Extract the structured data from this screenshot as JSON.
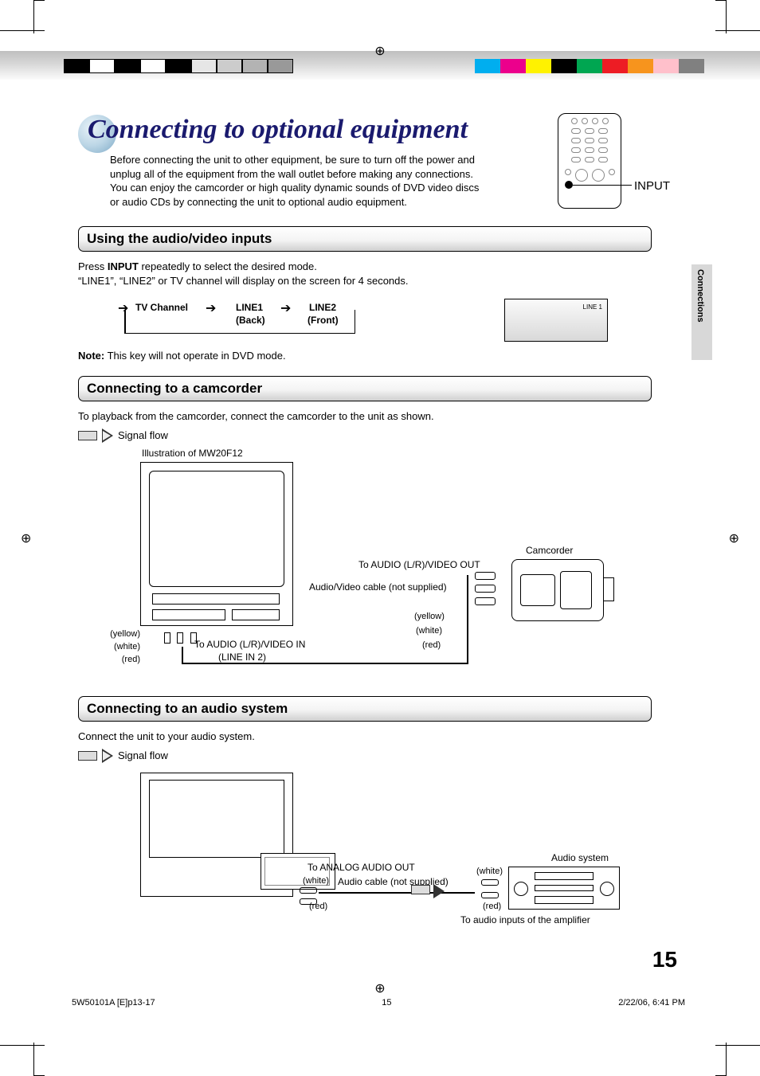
{
  "swatches_left": [
    "#000000",
    "#ffffff",
    "#000000",
    "#ffffff",
    "#000000",
    "#e6e6e6",
    "#cccccc",
    "#b3b3b3",
    "#999999"
  ],
  "swatches_right": [
    "#00aeef",
    "#ec008c",
    "#fff200",
    "#000000",
    "#00a651",
    "#ed1c24",
    "#f7941d",
    "#ffc0cb",
    "#808080"
  ],
  "title": "Connecting to optional equipment",
  "intro": "Before connecting the unit to other equipment, be sure to turn off the power and unplug all of the equipment from the wall outlet before making any connections. You can enjoy the camcorder or high quality dynamic sounds of DVD video discs or audio CDs by connecting the unit to optional audio equipment.",
  "input_label": "INPUT",
  "section1": {
    "heading": "Using the audio/video inputs",
    "line1_a": "Press ",
    "line1_b": "INPUT",
    "line1_c": " repeatedly to select the desired mode.",
    "line2": "“LINE1”, “LINE2” or TV channel will display on the screen for 4 seconds.",
    "cycle": {
      "stop1": "TV Channel",
      "stop2": "LINE1",
      "stop2_sub": "(Back)",
      "stop3": "LINE2",
      "stop3_sub": "(Front)"
    },
    "osd_label": "LINE 1",
    "note_b": "Note:",
    "note": " This key will not operate in DVD mode."
  },
  "section2": {
    "heading": "Connecting to a camcorder",
    "intro": "To playback from the camcorder, connect the camcorder to the unit as shown.",
    "signal_flow": "Signal flow",
    "illus": "Illustration of MW20F12",
    "labels": {
      "yellow": "(yellow)",
      "white": "(white)",
      "red": "(red)",
      "to_av_in_a": "To AUDIO (L/R)/VIDEO IN",
      "to_av_in_b": "(LINE IN 2)",
      "to_av_out": "To AUDIO (L/R)/VIDEO OUT",
      "cable": "Audio/Video cable (not supplied)",
      "camcorder": "Camcorder"
    }
  },
  "section3": {
    "heading": "Connecting to an audio system",
    "intro": "Connect the unit to your audio system.",
    "signal_flow": "Signal flow",
    "labels": {
      "to_analog": "To ANALOG AUDIO OUT",
      "cable": "Audio cable (not supplied)",
      "white": "(white)",
      "red": "(red)",
      "audio_system": "Audio system",
      "amp_inputs": "To audio inputs of the amplifier"
    }
  },
  "side_tab": "Connections",
  "page_number": "15",
  "footer": {
    "left": "5W50101A [E]p13-17",
    "center": "15",
    "right": "2/22/06, 6:41 PM"
  }
}
